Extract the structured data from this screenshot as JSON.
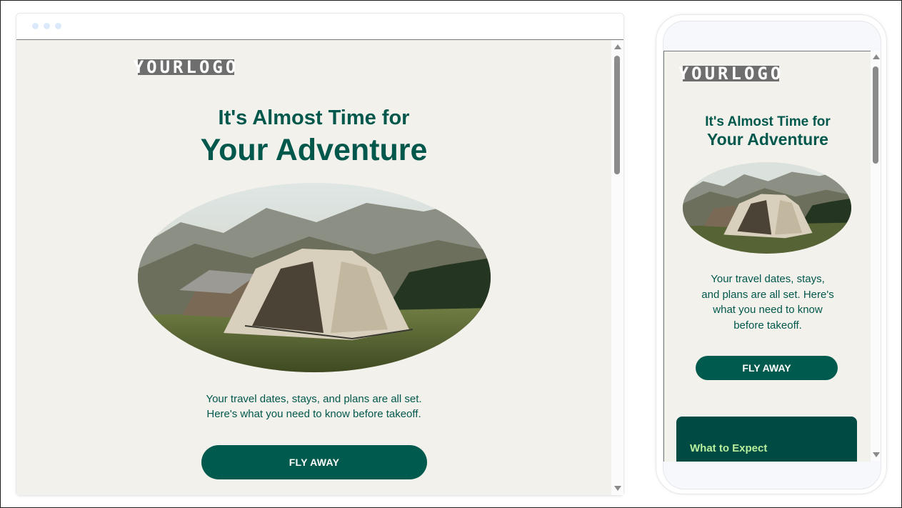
{
  "email": {
    "logo": "YOURLOGO",
    "headline_line1": "It's Almost Time for",
    "headline_line2": "Your Adventure",
    "intro_line1": "Your travel dates, stays, and plans are all set.",
    "intro_line2": "Here's what you need to know before takeoff.",
    "mobile_intro_lines": [
      "Your travel dates, stays,",
      "and plans are all set. Here's",
      "what you need to know",
      "before takeoff."
    ],
    "cta_label": "FLY AWAY",
    "section_title": "What to Expect",
    "hero_image": "camping tent in mountain meadow"
  },
  "colors": {
    "background": "#f3f1eb",
    "brand_green": "#00574c",
    "button": "#005a4d",
    "card": "#004a44",
    "card_title": "#b8ef9c",
    "logo_bg": "#6e6e6e"
  }
}
